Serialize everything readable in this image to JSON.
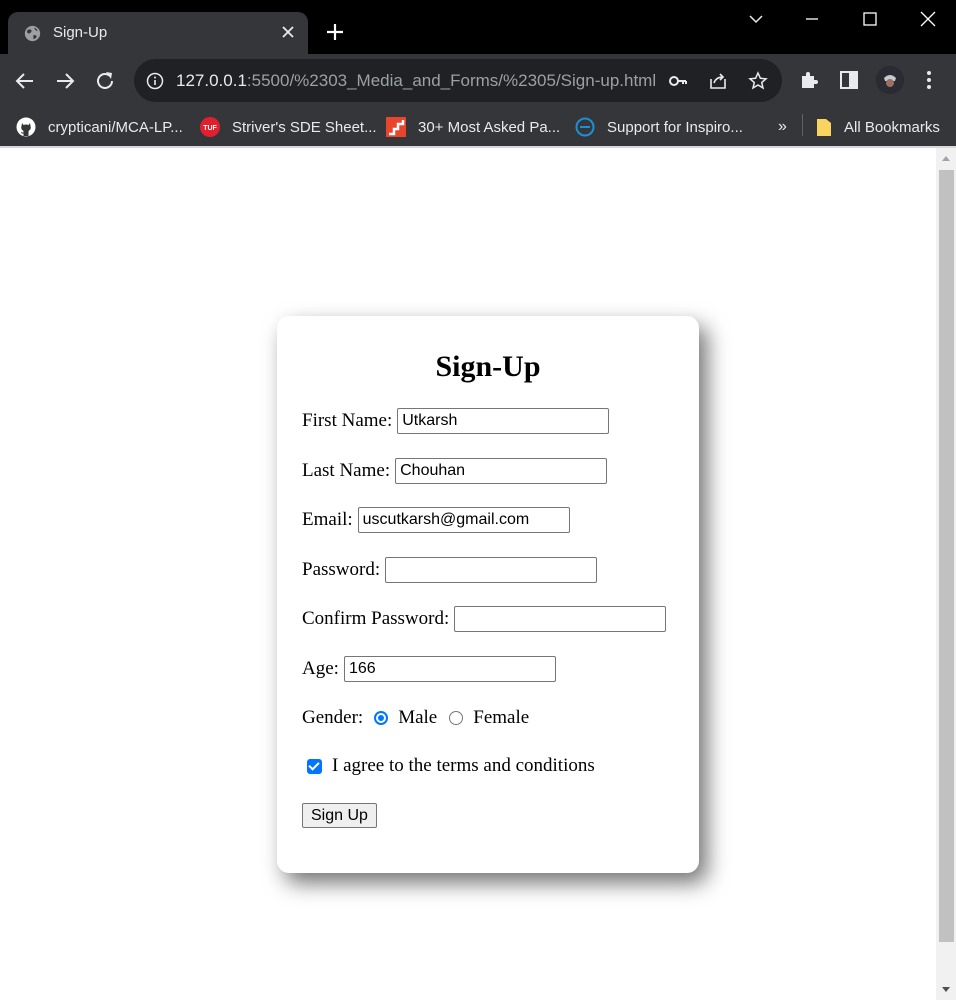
{
  "browser": {
    "tab": {
      "title": "Sign-Up"
    },
    "address": {
      "host": "127.0.0.1",
      "rest": ":5500/%2303_Media_and_Forms/%2305/Sign-up.html"
    },
    "bookmarks": [
      {
        "label": "crypticani/MCA-LP...",
        "icon": "github-icon"
      },
      {
        "label": "Striver's SDE Sheet...",
        "icon": "tuf-icon"
      },
      {
        "label": "30+ Most Asked Pa...",
        "icon": "stairs-icon"
      },
      {
        "label": "Support for Inspiro...",
        "icon": "dell-icon"
      }
    ],
    "overflow": "»",
    "all_bookmarks": "All Bookmarks"
  },
  "form": {
    "title": "Sign-Up",
    "first_name": {
      "label": "First Name:",
      "value": "Utkarsh"
    },
    "last_name": {
      "label": "Last Name:",
      "value": "Chouhan"
    },
    "email": {
      "label": "Email:",
      "value": "uscutkarsh@gmail.com"
    },
    "password": {
      "label": "Password:",
      "value": ""
    },
    "confirm_password": {
      "label": "Confirm Password:",
      "value": ""
    },
    "age": {
      "label": "Age:",
      "value": "166"
    },
    "gender": {
      "label": "Gender:",
      "options": [
        "Male",
        "Female"
      ],
      "selected": "Male"
    },
    "terms": {
      "label": "I agree to the terms and conditions",
      "checked": true
    },
    "submit_label": "Sign Up"
  },
  "colors": {
    "accent": "#0075ff",
    "chrome_dark": "#35363a",
    "titlebar": "#000000"
  }
}
